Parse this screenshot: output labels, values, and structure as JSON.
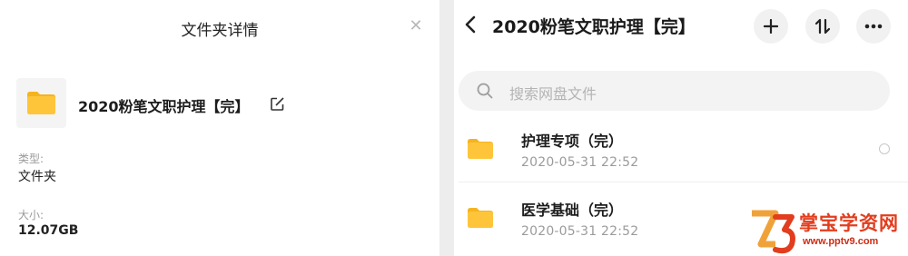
{
  "details_panel": {
    "title": "文件夹详情",
    "close_icon": "close-icon",
    "folder_name": "2020粉笔文职护理【完】",
    "edit_icon": "edit-icon",
    "type_label": "类型:",
    "type_value": "文件夹",
    "size_label": "大小:",
    "size_value": "12.07GB"
  },
  "list_panel": {
    "title": "2020粉笔文职护理【完】",
    "back_icon": "chevron-left-icon",
    "actions": [
      "plus-icon",
      "sort-icon",
      "more-icon"
    ],
    "search_placeholder": "搜索网盘文件",
    "items": [
      {
        "name": "护理专项（完）",
        "date": "2020-05-31   22:52"
      },
      {
        "name": "医学基础（完）",
        "date": "2020-05-31   22:52"
      }
    ]
  },
  "watermark": {
    "text": "掌宝学资网",
    "url": "www.pptv9.com"
  },
  "colors": {
    "folder": "#ffc53a",
    "folder_tab": "#f5b41f",
    "watermark": "#e23d1e"
  }
}
